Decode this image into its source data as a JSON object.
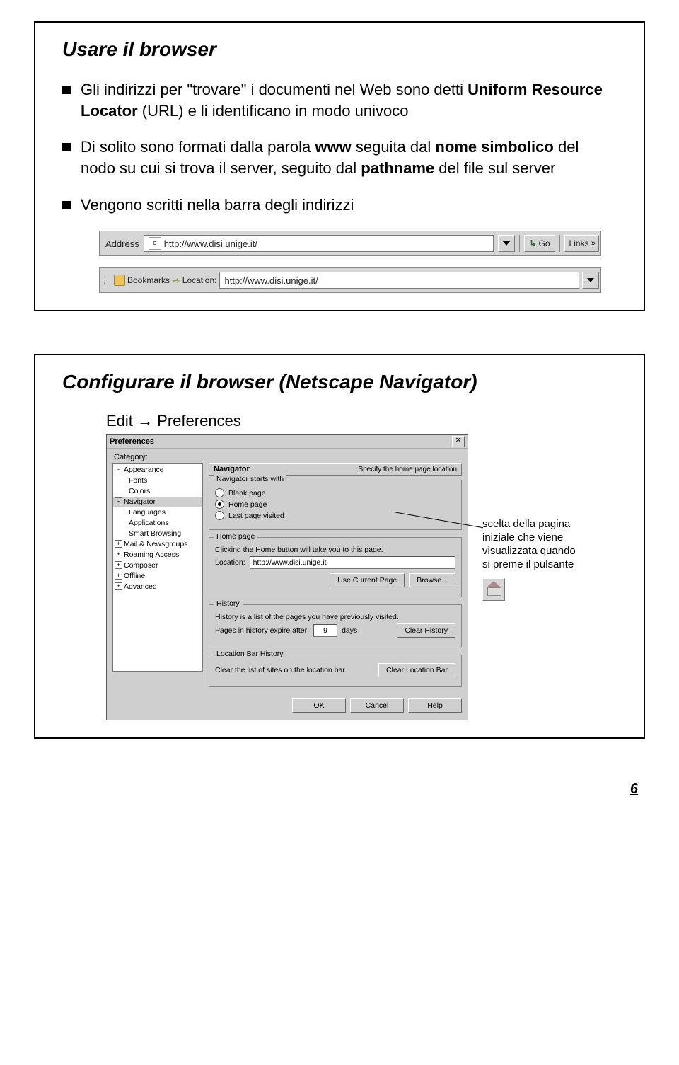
{
  "slide1": {
    "title": "Usare il browser",
    "bullets": {
      "b1a": "Gli indirizzi per \"trovare\" i documenti nel Web sono detti ",
      "b1b": "Uniform Resource Locator",
      "b1c": " (URL) e li identificano in modo univoco",
      "b2a": "Di solito sono formati dalla parola ",
      "b2b": "www",
      "b2c": " seguita dal ",
      "b2d": "nome simbolico",
      "b2e": " del nodo su cui si trova il server, seguito dal ",
      "b2f": "pathname",
      "b2g": " del file sul server",
      "b3": "Vengono scritti nella barra degli indirizzi"
    },
    "addressbar": {
      "label": "Address",
      "url": "http://www.disi.unige.it/",
      "go": "Go",
      "links": "Links"
    },
    "locationbar": {
      "bookmarks": "Bookmarks",
      "location_label": "Location:",
      "url": "http://www.disi.unige.it/"
    }
  },
  "slide2": {
    "title": "Configurare il browser (Netscape Navigator)",
    "edit_pref": {
      "edit": "Edit",
      "arrow": "→",
      "preferences": "Preferences"
    },
    "dialog": {
      "title": "Preferences",
      "category_label": "Category:",
      "tree": {
        "appearance": "Appearance",
        "fonts": "Fonts",
        "colors": "Colors",
        "navigator": "Navigator",
        "languages": "Languages",
        "applications": "Applications",
        "smart": "Smart Browsing",
        "mail": "Mail & Newsgroups",
        "roaming": "Roaming Access",
        "composer": "Composer",
        "offline": "Offline",
        "advanced": "Advanced"
      },
      "header_name": "Navigator",
      "header_desc": "Specify the home page location",
      "starts_with": {
        "legend": "Navigator starts with",
        "blank": "Blank page",
        "home": "Home page",
        "last": "Last page visited"
      },
      "home_page": {
        "legend": "Home page",
        "desc": "Clicking the Home button will take you to this page.",
        "loc_label": "Location:",
        "loc_value": "http://www.disi.unige.it",
        "use_current": "Use Current Page",
        "browse": "Browse..."
      },
      "history": {
        "legend": "History",
        "desc": "History is a list of the pages you have previously visited.",
        "expire_a": "Pages in history expire after:",
        "days_value": "9",
        "days_label": "days",
        "clear": "Clear History"
      },
      "locbar_hist": {
        "legend": "Location Bar History",
        "desc": "Clear the list of sites on the location bar.",
        "clear": "Clear Location Bar"
      },
      "buttons": {
        "ok": "OK",
        "cancel": "Cancel",
        "help": "Help"
      }
    },
    "callout": "scelta della pagina iniziale che viene visualizzata quando si preme il pulsante"
  },
  "page_number": "6"
}
